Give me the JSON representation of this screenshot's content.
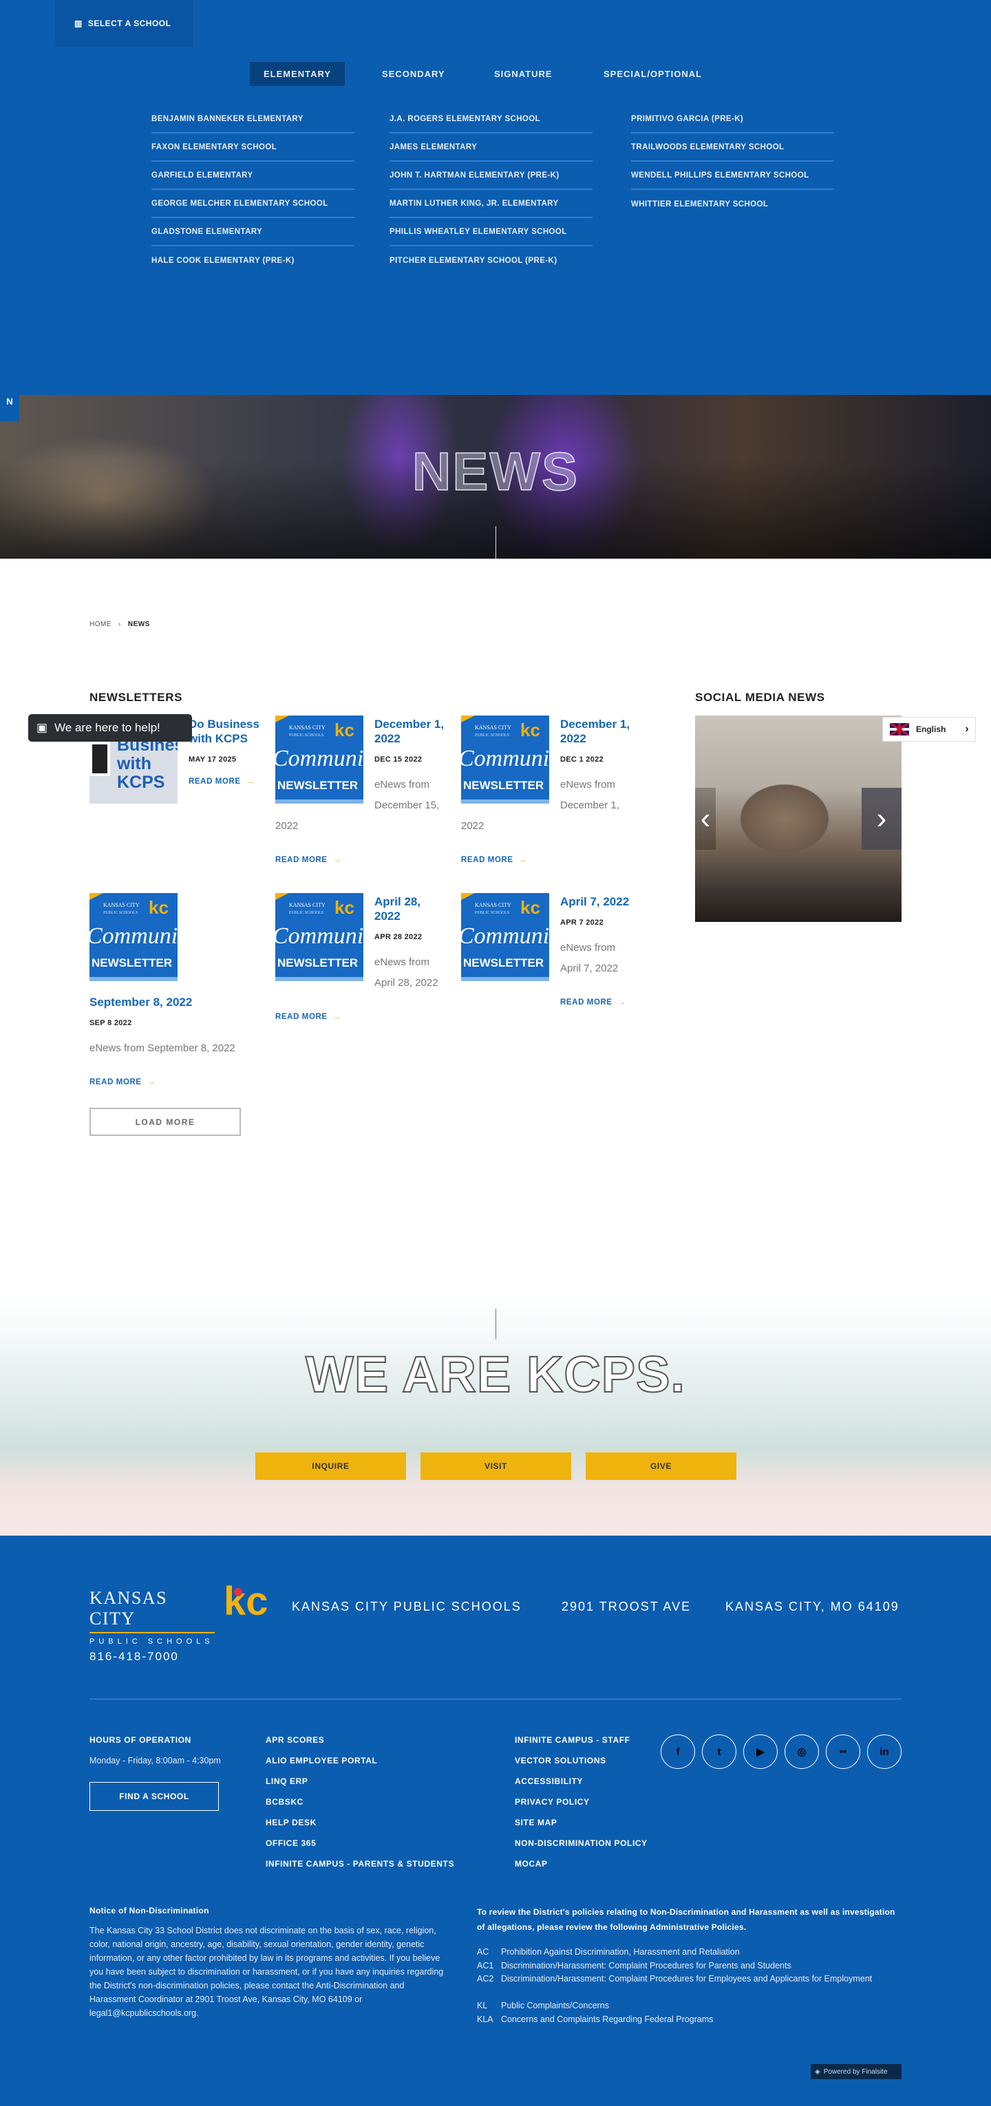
{
  "header": {
    "select_school": "SELECT A SCHOOL",
    "tabs": [
      "ELEMENTARY",
      "SECONDARY",
      "SIGNATURE",
      "SPECIAL/OPTIONAL"
    ],
    "schools": [
      [
        "BENJAMIN BANNEKER ELEMENTARY",
        "FAXON ELEMENTARY SCHOOL",
        "GARFIELD ELEMENTARY",
        "GEORGE MELCHER ELEMENTARY SCHOOL",
        "GLADSTONE ELEMENTARY",
        "HALE COOK ELEMENTARY (PRE-K)"
      ],
      [
        "J.A. ROGERS ELEMENTARY SCHOOL",
        "JAMES ELEMENTARY",
        "JOHN T. HARTMAN ELEMENTARY (PRE-K)",
        "MARTIN LUTHER KING, JR. ELEMENTARY",
        "PHILLIS WHEATLEY ELEMENTARY SCHOOL",
        "PITCHER ELEMENTARY SCHOOL (PRE-K)"
      ],
      [
        "PRIMITIVO GARCIA (PRE-K)",
        "TRAILWOODS ELEMENTARY SCHOOL",
        "WENDELL PHILLIPS ELEMENTARY SCHOOL",
        "WHITTIER ELEMENTARY SCHOOL"
      ]
    ]
  },
  "side_tab": "N",
  "hero": {
    "title": "NEWS"
  },
  "breadcrumb": {
    "home": "HOME",
    "current": "NEWS"
  },
  "newsletters": {
    "heading": "NEWSLETTERS",
    "read_more": "READ MORE",
    "arrow": "→",
    "load_more": "LOAD MORE",
    "thumb": {
      "logo1": "KANSAS CITY",
      "logo2": "PUBLIC SCHOOLS",
      "kc": "kc",
      "script": "Community",
      "word": "NEWSLETTER",
      "biz": "Busines with KCPS"
    },
    "items": [
      {
        "title": "Do Business with KCPS",
        "date": "MAY 17 2025",
        "excerpt": ""
      },
      {
        "title": "December 1, 2022",
        "date": "DEC 15 2022",
        "excerpt": "eNews from December 15, 2022"
      },
      {
        "title": "December 1, 2022",
        "date": "DEC 1 2022",
        "excerpt": "eNews from December 1, 2022"
      },
      {
        "title": "September 8, 2022",
        "date": "SEP 8 2022",
        "excerpt": "eNews from September 8, 2022"
      },
      {
        "title": "April 28, 2022",
        "date": "APR 28 2022",
        "excerpt": "eNews from April 28, 2022"
      },
      {
        "title": "April 7, 2022",
        "date": "APR 7 2022",
        "excerpt": "eNews from April 7, 2022"
      }
    ]
  },
  "social_news": {
    "heading": "SOCIAL MEDIA NEWS",
    "prev": "‹",
    "next": "›"
  },
  "language": {
    "label": "English",
    "chevron": "›"
  },
  "chat": {
    "label": "We are here to help!"
  },
  "kcps": {
    "title": "WE ARE KCPS.",
    "buttons": [
      "INQUIRE",
      "VISIT",
      "GIVE"
    ]
  },
  "footer": {
    "logo_top": "KANSAS CITY",
    "logo_bottom": "PUBLIC SCHOOLS",
    "name": "KANSAS CITY PUBLIC SCHOOLS",
    "address": "2901 TROOST AVE",
    "city": "KANSAS CITY, MO 64109",
    "phone": "816-418-7000",
    "hours_label": "HOURS OF OPERATION",
    "hours": "Monday - Friday, 8:00am - 4:30pm",
    "find_school": "FIND A SCHOOL",
    "links1": [
      "APR SCORES",
      "ALIO EMPLOYEE PORTAL",
      "LINQ ERP",
      "BCBSKC",
      "HELP DESK",
      "OFFICE 365",
      "INFINITE CAMPUS - PARENTS & STUDENTS"
    ],
    "links2": [
      "INFINITE CAMPUS - STAFF",
      "VECTOR SOLUTIONS",
      "ACCESSIBILITY",
      "PRIVACY POLICY",
      "SITE MAP",
      "NON-DISCRIMINATION POLICY",
      "MOCAP"
    ],
    "social": [
      {
        "name": "facebook",
        "glyph": "f"
      },
      {
        "name": "twitter",
        "glyph": "t"
      },
      {
        "name": "youtube",
        "glyph": "▶"
      },
      {
        "name": "instagram",
        "glyph": "◎"
      },
      {
        "name": "flickr",
        "glyph": "••"
      },
      {
        "name": "linkedin",
        "glyph": "in"
      }
    ],
    "notice_title": "Notice of Non-Discrimination",
    "notice_text": "The Kansas City 33 School District does not discriminate on the basis of sex, race, religion, color, national origin, ancestry, age, disability, sexual orientation, gender identity, genetic information, or any other factor prohibited by law in its programs and activities. If you believe you have been subject to discrimination or harassment, or if you have any inquiries regarding the District's non-discrimination policies, please contact the Anti-Discrimination and Harassment Coordinator at 2901 Troost Ave, Kansas City, MO 64109 or legal1@kcpublicschools.org.",
    "policies_intro": "To review the District's policies relating to Non-Discrimination and Harassment as well as investigation of allegations, please review the following Administrative Policies.",
    "policies": [
      {
        "code": "AC",
        "text": "Prohibition Against Discrimination, Harassment and Retaliation"
      },
      {
        "code": "AC1",
        "text": "Discrimination/Harassment: Complaint Procedures for Parents and Students"
      },
      {
        "code": "AC2",
        "text": "Discrimination/Harassment: Complaint Procedures for Employees and Applicants for Employment"
      },
      {
        "code": "KL",
        "text": "Public Complaints/Concerns"
      },
      {
        "code": "KLA",
        "text": "Concerns and Complaints Regarding Federal Programs"
      }
    ],
    "powered": "Powered by Finalsite"
  }
}
